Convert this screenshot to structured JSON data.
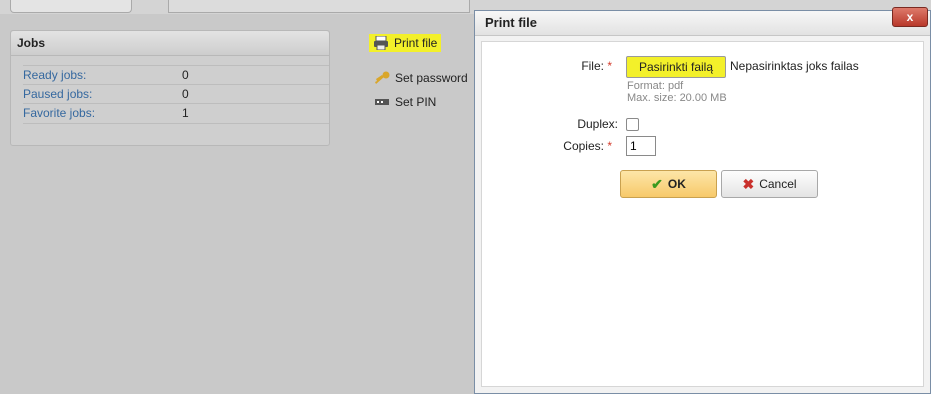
{
  "jobs": {
    "title": "Jobs",
    "rows": [
      {
        "label": "Ready jobs:",
        "value": "0"
      },
      {
        "label": "Paused jobs:",
        "value": "0"
      },
      {
        "label": "Favorite jobs:",
        "value": "1"
      }
    ]
  },
  "actions": {
    "print_file": "Print file",
    "set_password": "Set password",
    "set_pin": "Set PIN"
  },
  "dialog": {
    "title": "Print file",
    "close_label": "x",
    "file_label": "File:",
    "file_button": "Pasirinkti failą",
    "file_none": "Nepasirinktas joks failas",
    "format_hint": "Format: pdf",
    "size_hint": "Max. size: 20.00 MB",
    "duplex_label": "Duplex:",
    "duplex_checked": false,
    "copies_label": "Copies:",
    "copies_value": "1",
    "ok_label": "OK",
    "cancel_label": "Cancel",
    "required_marker": "*"
  },
  "colors": {
    "highlight": "#f3f02a",
    "link": "#35689f",
    "required": "#d23a2a"
  }
}
